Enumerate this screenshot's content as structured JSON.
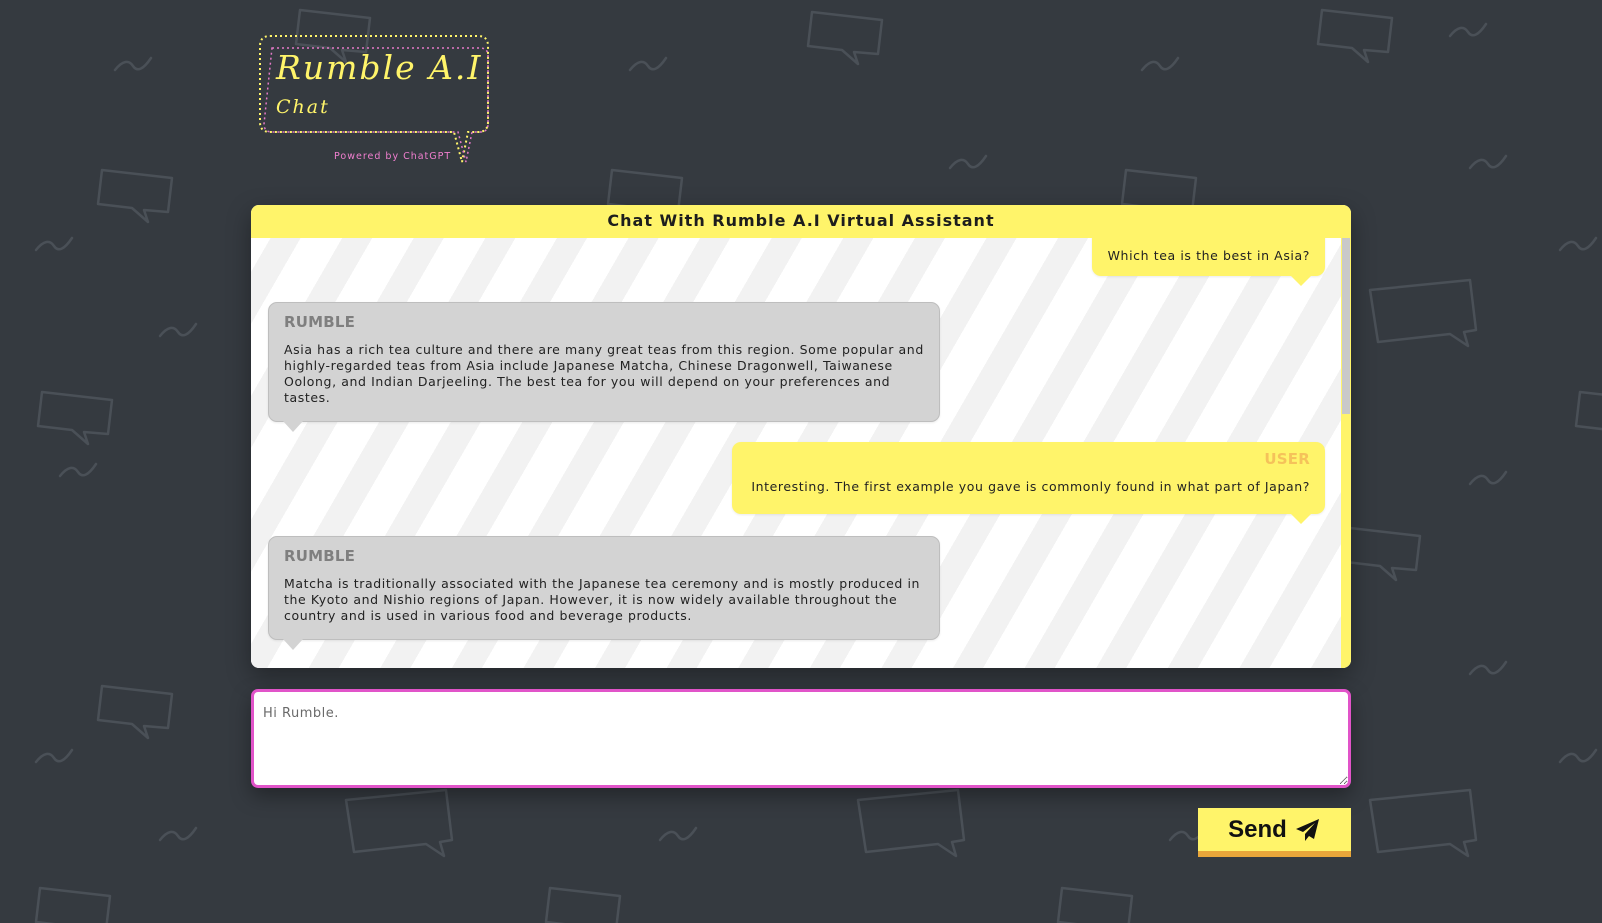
{
  "logo": {
    "title": "Rumble A.I",
    "subtitle": "Chat",
    "powered_by": "Powered by ChatGPT"
  },
  "chat": {
    "header": "Chat With Rumble A.I Virtual Assistant",
    "messages": [
      {
        "role": "user",
        "sender": "",
        "text": "Which tea is the best in Asia?"
      },
      {
        "role": "bot",
        "sender": "RUMBLE",
        "text": "Asia has a rich tea culture and there are many great teas from this region. Some popular and highly-regarded teas from Asia include Japanese Matcha, Chinese Dragonwell, Taiwanese Oolong, and Indian Darjeeling. The best tea for you will depend on your preferences and tastes."
      },
      {
        "role": "user",
        "sender": "USER",
        "text": "Interesting. The first example you gave is commonly found in what part of Japan?"
      },
      {
        "role": "bot",
        "sender": "RUMBLE",
        "text": "Matcha is traditionally associated with the Japanese tea ceremony and is mostly produced in the Kyoto and Nishio regions of Japan. However, it is now widely available throughout the country and is used in various food and beverage products."
      }
    ]
  },
  "input": {
    "placeholder": "Hi Rumble.",
    "value": ""
  },
  "send_button": {
    "label": "Send",
    "icon": "paper-plane-icon"
  },
  "colors": {
    "background": "#353a40",
    "accent_yellow": "#fff46a",
    "input_border": "#e154c9",
    "bot_bubble": "#d3d3d3",
    "user_sender": "#f5c25a",
    "button_border": "#e9a63a"
  }
}
